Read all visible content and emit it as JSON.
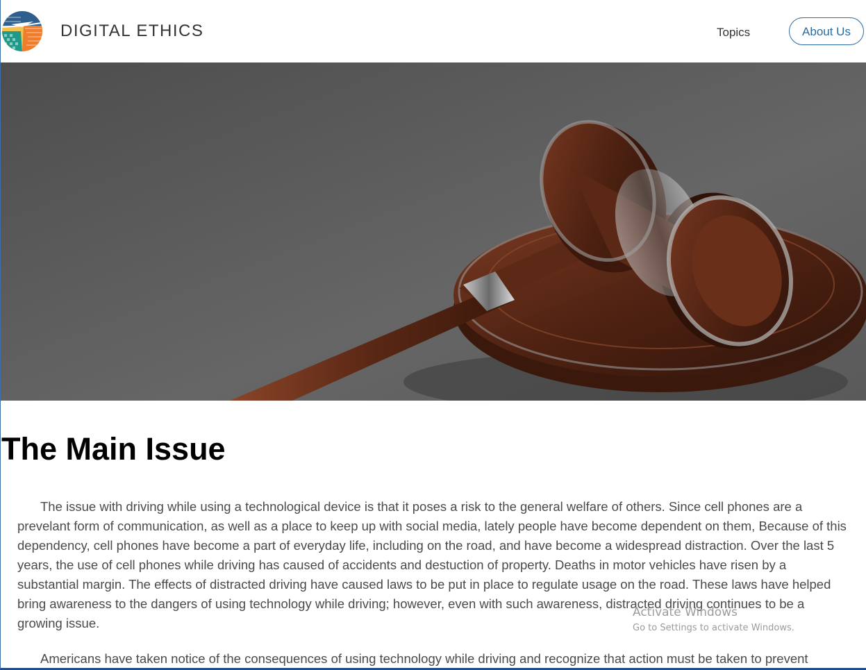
{
  "header": {
    "site_title": "DIGITAL ETHICS",
    "logo_icon": "globe-logo-icon",
    "nav": {
      "topics": "Topics",
      "about": "About Us"
    },
    "colors": {
      "accent": "#2b6aa0"
    }
  },
  "hero": {
    "image": "judge-gavel-image"
  },
  "main": {
    "title": "The Main Issue",
    "paragraphs": [
      "The issue with driving while using a technological device is that it poses a risk to the general welfare of others. Since cell phones are a prevelant form of communication, as well as a place to keep up with social media, lately people have become dependent on them, Because of this dependency, cell phones have become a part of everyday life, including on the road, and have become a widespread distraction. Over the last 5 years, the use of cell phones while driving has caused of accidents and destuction of property. Deaths in motor vehicles have risen by a substantial margin. The effects of distracted driving have caused laws to be put in place to regulate usage on the road. These laws have helped bring awareness to the dangers of using technology while driving; however, even with such awareness, distracted driving continues to be a growing issue.",
      "Americans have taken notice of the consequences of using technology while driving and recognize that action must be taken to prevent"
    ]
  },
  "watermark": {
    "title": "Activate Windows",
    "subtitle": "Go to Settings to activate Windows."
  }
}
